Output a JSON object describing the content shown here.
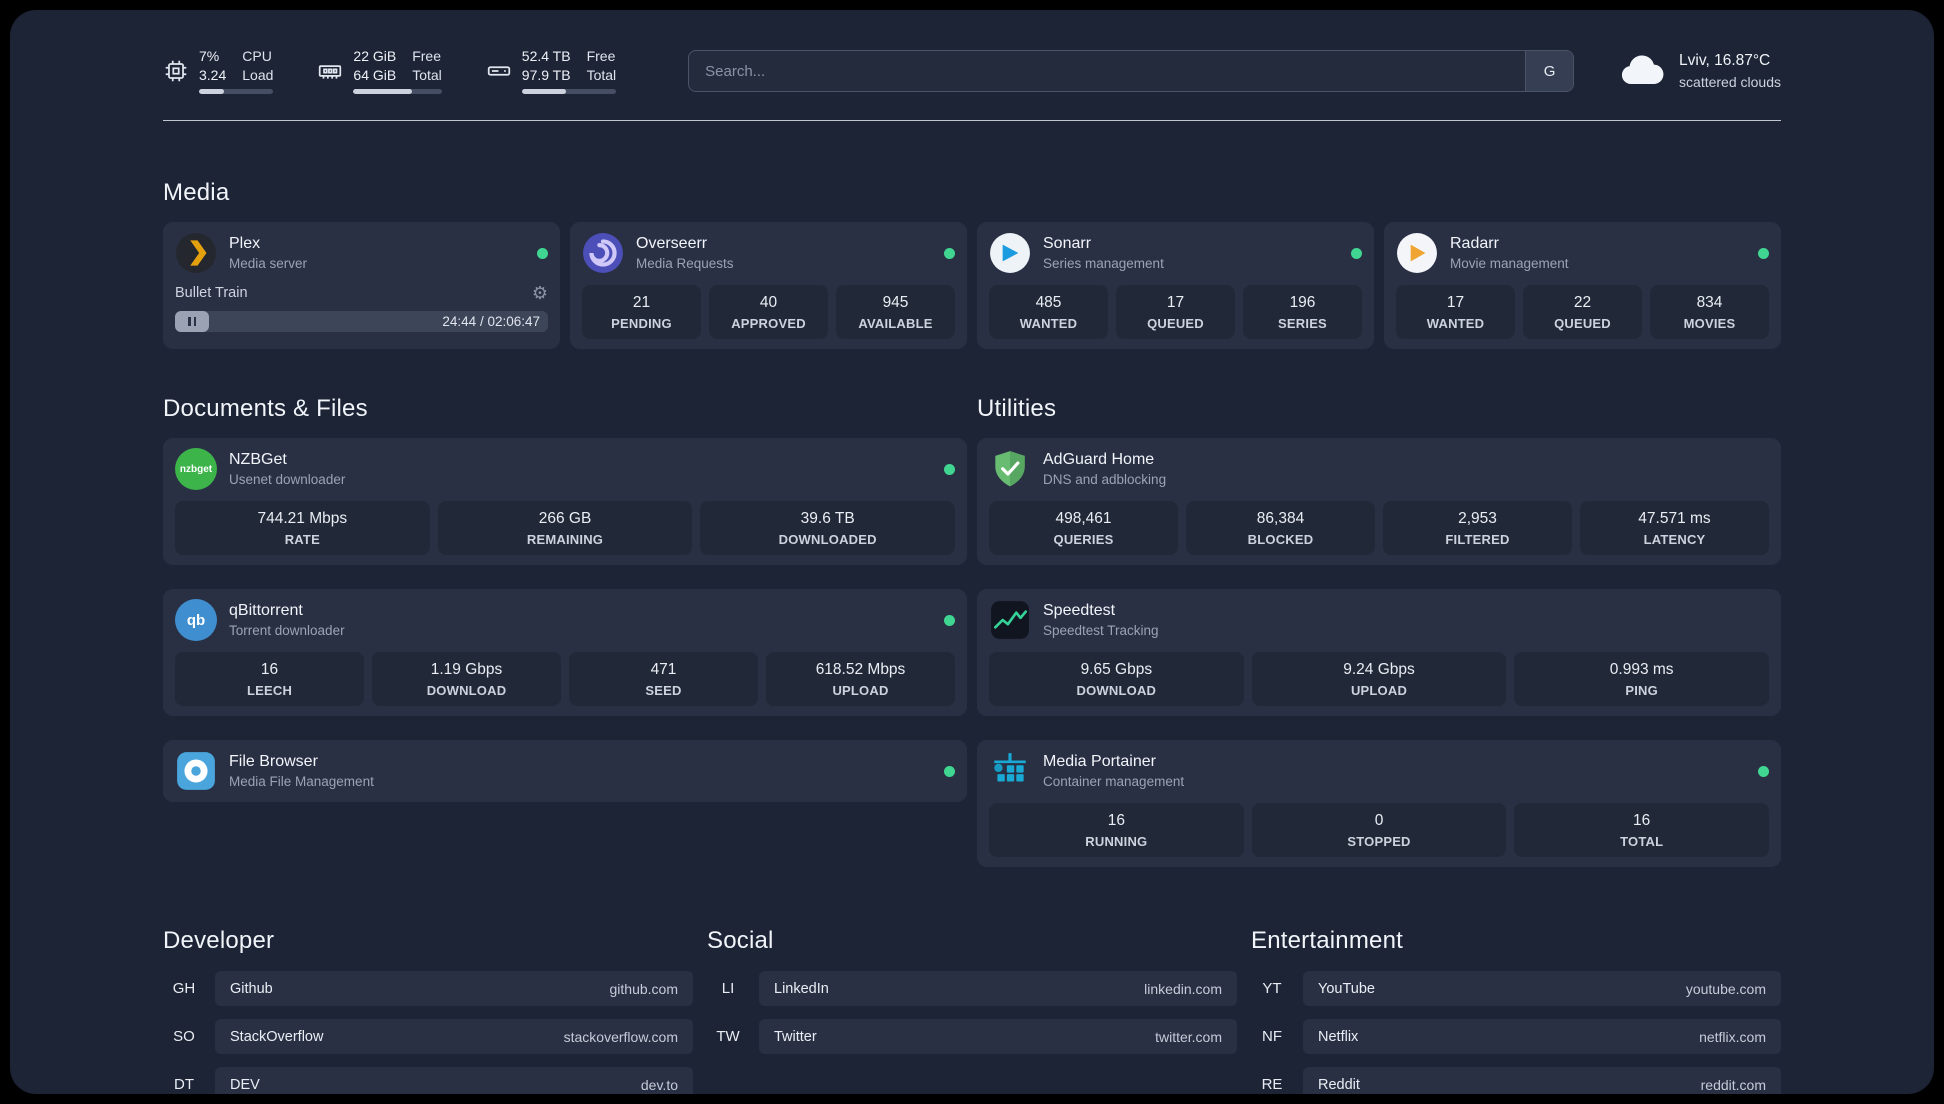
{
  "topbar": {
    "cpu": {
      "value1": "7%",
      "value2": "3.24",
      "label1": "CPU",
      "label2": "Load",
      "progress": 33
    },
    "memory": {
      "value1": "22 GiB",
      "value2": "64 GiB",
      "label1": "Free",
      "label2": "Total",
      "progress": 66
    },
    "disk": {
      "value1": "52.4 TB",
      "value2": "97.9 TB",
      "label1": "Free",
      "label2": "Total",
      "progress": 47
    },
    "search": {
      "placeholder": "Search...",
      "button_label": "G"
    },
    "weather": {
      "location": "Lviv, 16.87°C",
      "condition": "scattered clouds"
    }
  },
  "sections": {
    "media": "Media",
    "documents": "Documents & Files",
    "utilities": "Utilities",
    "developer": "Developer",
    "social": "Social",
    "entertainment": "Entertainment"
  },
  "apps": {
    "plex": {
      "name": "Plex",
      "subtitle": "Media server",
      "now_playing": "Bullet Train",
      "time": "24:44 / 02:06:47"
    },
    "overseerr": {
      "name": "Overseerr",
      "subtitle": "Media Requests",
      "stats": [
        {
          "value": "21",
          "label": "PENDING"
        },
        {
          "value": "40",
          "label": "APPROVED"
        },
        {
          "value": "945",
          "label": "AVAILABLE"
        }
      ]
    },
    "sonarr": {
      "name": "Sonarr",
      "subtitle": "Series management",
      "stats": [
        {
          "value": "485",
          "label": "WANTED"
        },
        {
          "value": "17",
          "label": "QUEUED"
        },
        {
          "value": "196",
          "label": "SERIES"
        }
      ]
    },
    "radarr": {
      "name": "Radarr",
      "subtitle": "Movie management",
      "stats": [
        {
          "value": "17",
          "label": "WANTED"
        },
        {
          "value": "22",
          "label": "QUEUED"
        },
        {
          "value": "834",
          "label": "MOVIES"
        }
      ]
    },
    "nzbget": {
      "name": "NZBGet",
      "subtitle": "Usenet downloader",
      "icon_text": "nzbget",
      "stats": [
        {
          "value": "744.21 Mbps",
          "label": "RATE"
        },
        {
          "value": "266 GB",
          "label": "REMAINING"
        },
        {
          "value": "39.6 TB",
          "label": "DOWNLOADED"
        }
      ]
    },
    "qbittorrent": {
      "name": "qBittorrent",
      "subtitle": "Torrent downloader",
      "icon_text": "qb",
      "stats": [
        {
          "value": "16",
          "label": "LEECH"
        },
        {
          "value": "1.19 Gbps",
          "label": "DOWNLOAD"
        },
        {
          "value": "471",
          "label": "SEED"
        },
        {
          "value": "618.52 Mbps",
          "label": "UPLOAD"
        }
      ]
    },
    "filebrowser": {
      "name": "File Browser",
      "subtitle": "Media File Management"
    },
    "adguard": {
      "name": "AdGuard Home",
      "subtitle": "DNS and adblocking",
      "stats": [
        {
          "value": "498,461",
          "label": "QUERIES"
        },
        {
          "value": "86,384",
          "label": "BLOCKED"
        },
        {
          "value": "2,953",
          "label": "FILTERED"
        },
        {
          "value": "47.571 ms",
          "label": "LATENCY"
        }
      ]
    },
    "speedtest": {
      "name": "Speedtest",
      "subtitle": "Speedtest Tracking",
      "stats": [
        {
          "value": "9.65 Gbps",
          "label": "DOWNLOAD"
        },
        {
          "value": "9.24 Gbps",
          "label": "UPLOAD"
        },
        {
          "value": "0.993 ms",
          "label": "PING"
        }
      ]
    },
    "portainer": {
      "name": "Media Portainer",
      "subtitle": "Container management",
      "stats": [
        {
          "value": "16",
          "label": "RUNNING"
        },
        {
          "value": "0",
          "label": "STOPPED"
        },
        {
          "value": "16",
          "label": "TOTAL"
        }
      ]
    }
  },
  "bookmarks": {
    "developer": [
      {
        "abbr": "GH",
        "name": "Github",
        "url": "github.com"
      },
      {
        "abbr": "SO",
        "name": "StackOverflow",
        "url": "stackoverflow.com"
      },
      {
        "abbr": "DT",
        "name": "DEV",
        "url": "dev.to"
      }
    ],
    "social": [
      {
        "abbr": "LI",
        "name": "LinkedIn",
        "url": "linkedin.com"
      },
      {
        "abbr": "TW",
        "name": "Twitter",
        "url": "twitter.com"
      }
    ],
    "entertainment": [
      {
        "abbr": "YT",
        "name": "YouTube",
        "url": "youtube.com"
      },
      {
        "abbr": "NF",
        "name": "Netflix",
        "url": "netflix.com"
      },
      {
        "abbr": "RE",
        "name": "Reddit",
        "url": "reddit.com"
      }
    ]
  },
  "colors": {
    "status_green": "#40d692",
    "plex_amber": "#e5a00d"
  }
}
